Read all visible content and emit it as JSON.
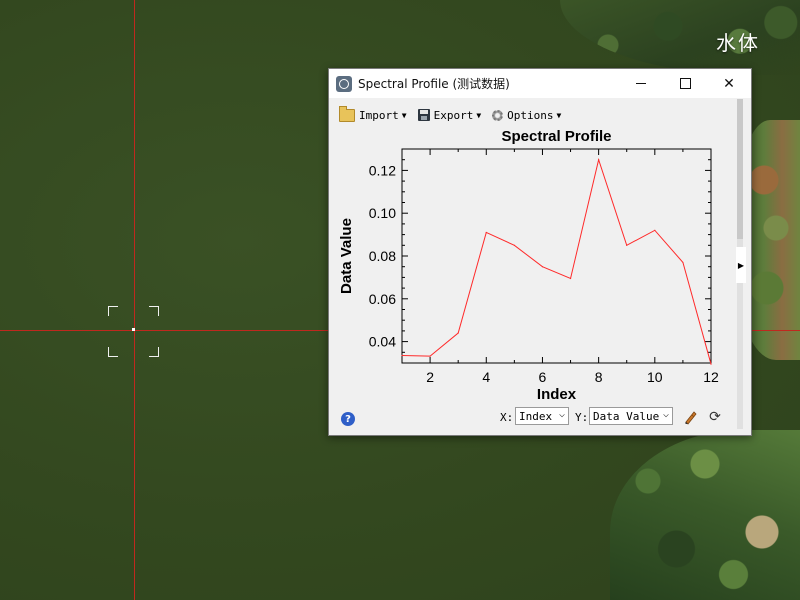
{
  "map": {
    "label": "水体",
    "crosshair_color": "#c0281e"
  },
  "window": {
    "title": "Spectral Profile (测试数据)",
    "minimize_icon": "minimize-icon",
    "maximize_icon": "maximize-icon",
    "close_glyph": "✕"
  },
  "toolbar": {
    "import_label": "Import",
    "export_label": "Export",
    "options_label": "Options",
    "caret": "▼"
  },
  "chart_data": {
    "type": "line",
    "title": "Spectral Profile",
    "xlabel": "Index",
    "ylabel": "Data Value",
    "x": [
      1,
      2,
      3,
      4,
      5,
      6,
      7,
      8,
      9,
      10,
      11,
      12
    ],
    "series": [
      {
        "values": [
          0.0335,
          0.0332,
          0.044,
          0.091,
          0.085,
          0.075,
          0.0695,
          0.125,
          0.085,
          0.092,
          0.077,
          0.0295
        ],
        "color": "#ff2a2a"
      }
    ],
    "xlim": [
      1,
      12
    ],
    "ylim": [
      0.03,
      0.13
    ],
    "xticks": [
      2,
      4,
      6,
      8,
      10,
      12
    ],
    "yticks": [
      0.04,
      0.06,
      0.08,
      0.1,
      0.12
    ],
    "ytick_labels": [
      "0.04",
      "0.06",
      "0.08",
      "0.10",
      "0.12"
    ],
    "grid": false,
    "legend": "none"
  },
  "footer": {
    "help_glyph": "?",
    "x_label": "X:",
    "x_value": "Index",
    "y_label": "Y:",
    "y_value": "Data Value",
    "chevron": "⌵",
    "refresh_glyph": "⟳"
  },
  "side": {
    "expand_glyph": "▶"
  }
}
